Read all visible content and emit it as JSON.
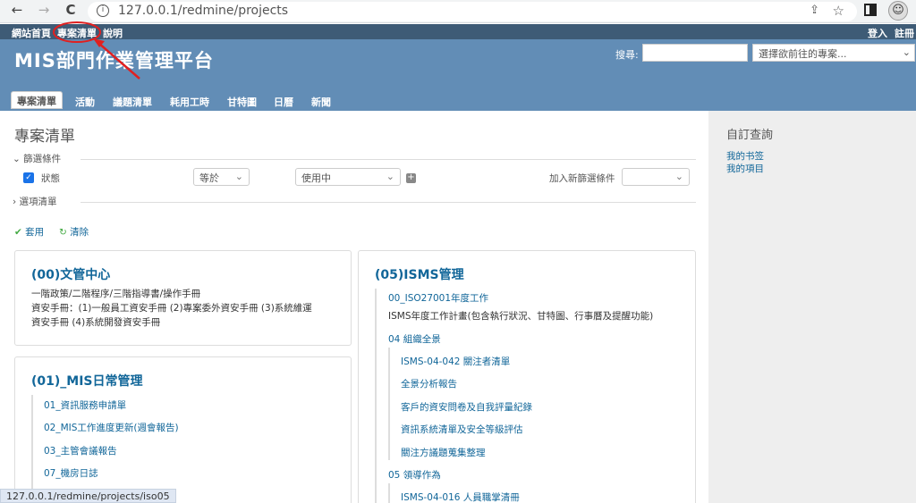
{
  "browser": {
    "url": "127.0.0.1/redmine/projects",
    "back_icon": "←",
    "forward_icon": "→",
    "reload_icon": "C"
  },
  "topmenu": {
    "items": [
      "網站首頁",
      "專案清單",
      "說明"
    ],
    "right": [
      "登入",
      "註冊"
    ]
  },
  "header": {
    "title": "MIS部門作業管理平台",
    "search_label": "搜尋:",
    "project_select": "選擇欲前往的專案..."
  },
  "tabs": [
    "專案清單",
    "活動",
    "議題清單",
    "耗用工時",
    "甘特圖",
    "日曆",
    "新聞"
  ],
  "page": {
    "title": "專案清單",
    "filters_legend": "篩選條件",
    "filter_field": "狀態",
    "operator": "等於",
    "value": "使用中",
    "add_filter_label": "加入新篩選條件",
    "options_legend": "選項清單",
    "apply": "套用",
    "clear": "清除"
  },
  "projects": {
    "left": [
      {
        "name": "(00)文管中心",
        "desc": [
          "一階政策/二階程序/三階指導書/操作手冊",
          "資安手冊：(1)一般員工資安手冊 (2)專案委外資安手冊 (3)系統維運",
          "資安手冊 (4)系統開發資安手冊"
        ]
      },
      {
        "name": "(01)_MIS日常管理",
        "subs": [
          "01_資訊服務申請單",
          "02_MIS工作進度更新(週會報告)",
          "03_主管會議報告",
          "07_機房日誌"
        ]
      }
    ],
    "right": {
      "name": "(05)ISMS管理",
      "sub1": "00_ISO27001年度工作",
      "sub1_desc": "ISMS年度工作計畫(包含執行狀況、甘特圖、行事曆及提醒功能)",
      "sub2": "04 組織全景",
      "sub2_children": [
        "ISMS-04-042 關注者清單",
        "全景分析報告",
        "客戶的資安問卷及自我評量紀錄",
        "資訊系統清單及安全等級評估",
        "關注方議題蒐集整理"
      ],
      "sub3": "05 領導作為",
      "sub3_children": [
        "ISMS-04-016 人員職掌清冊"
      ]
    }
  },
  "sidebar": {
    "title": "自訂查詢",
    "links": [
      "我的书签",
      "我的項目"
    ]
  },
  "statusbar": "127.0.0.1/redmine/projects/iso05",
  "colors": {
    "accent": "#628db6",
    "topbar": "#3e5b76",
    "link": "#116699",
    "annotation": "#e02020"
  }
}
